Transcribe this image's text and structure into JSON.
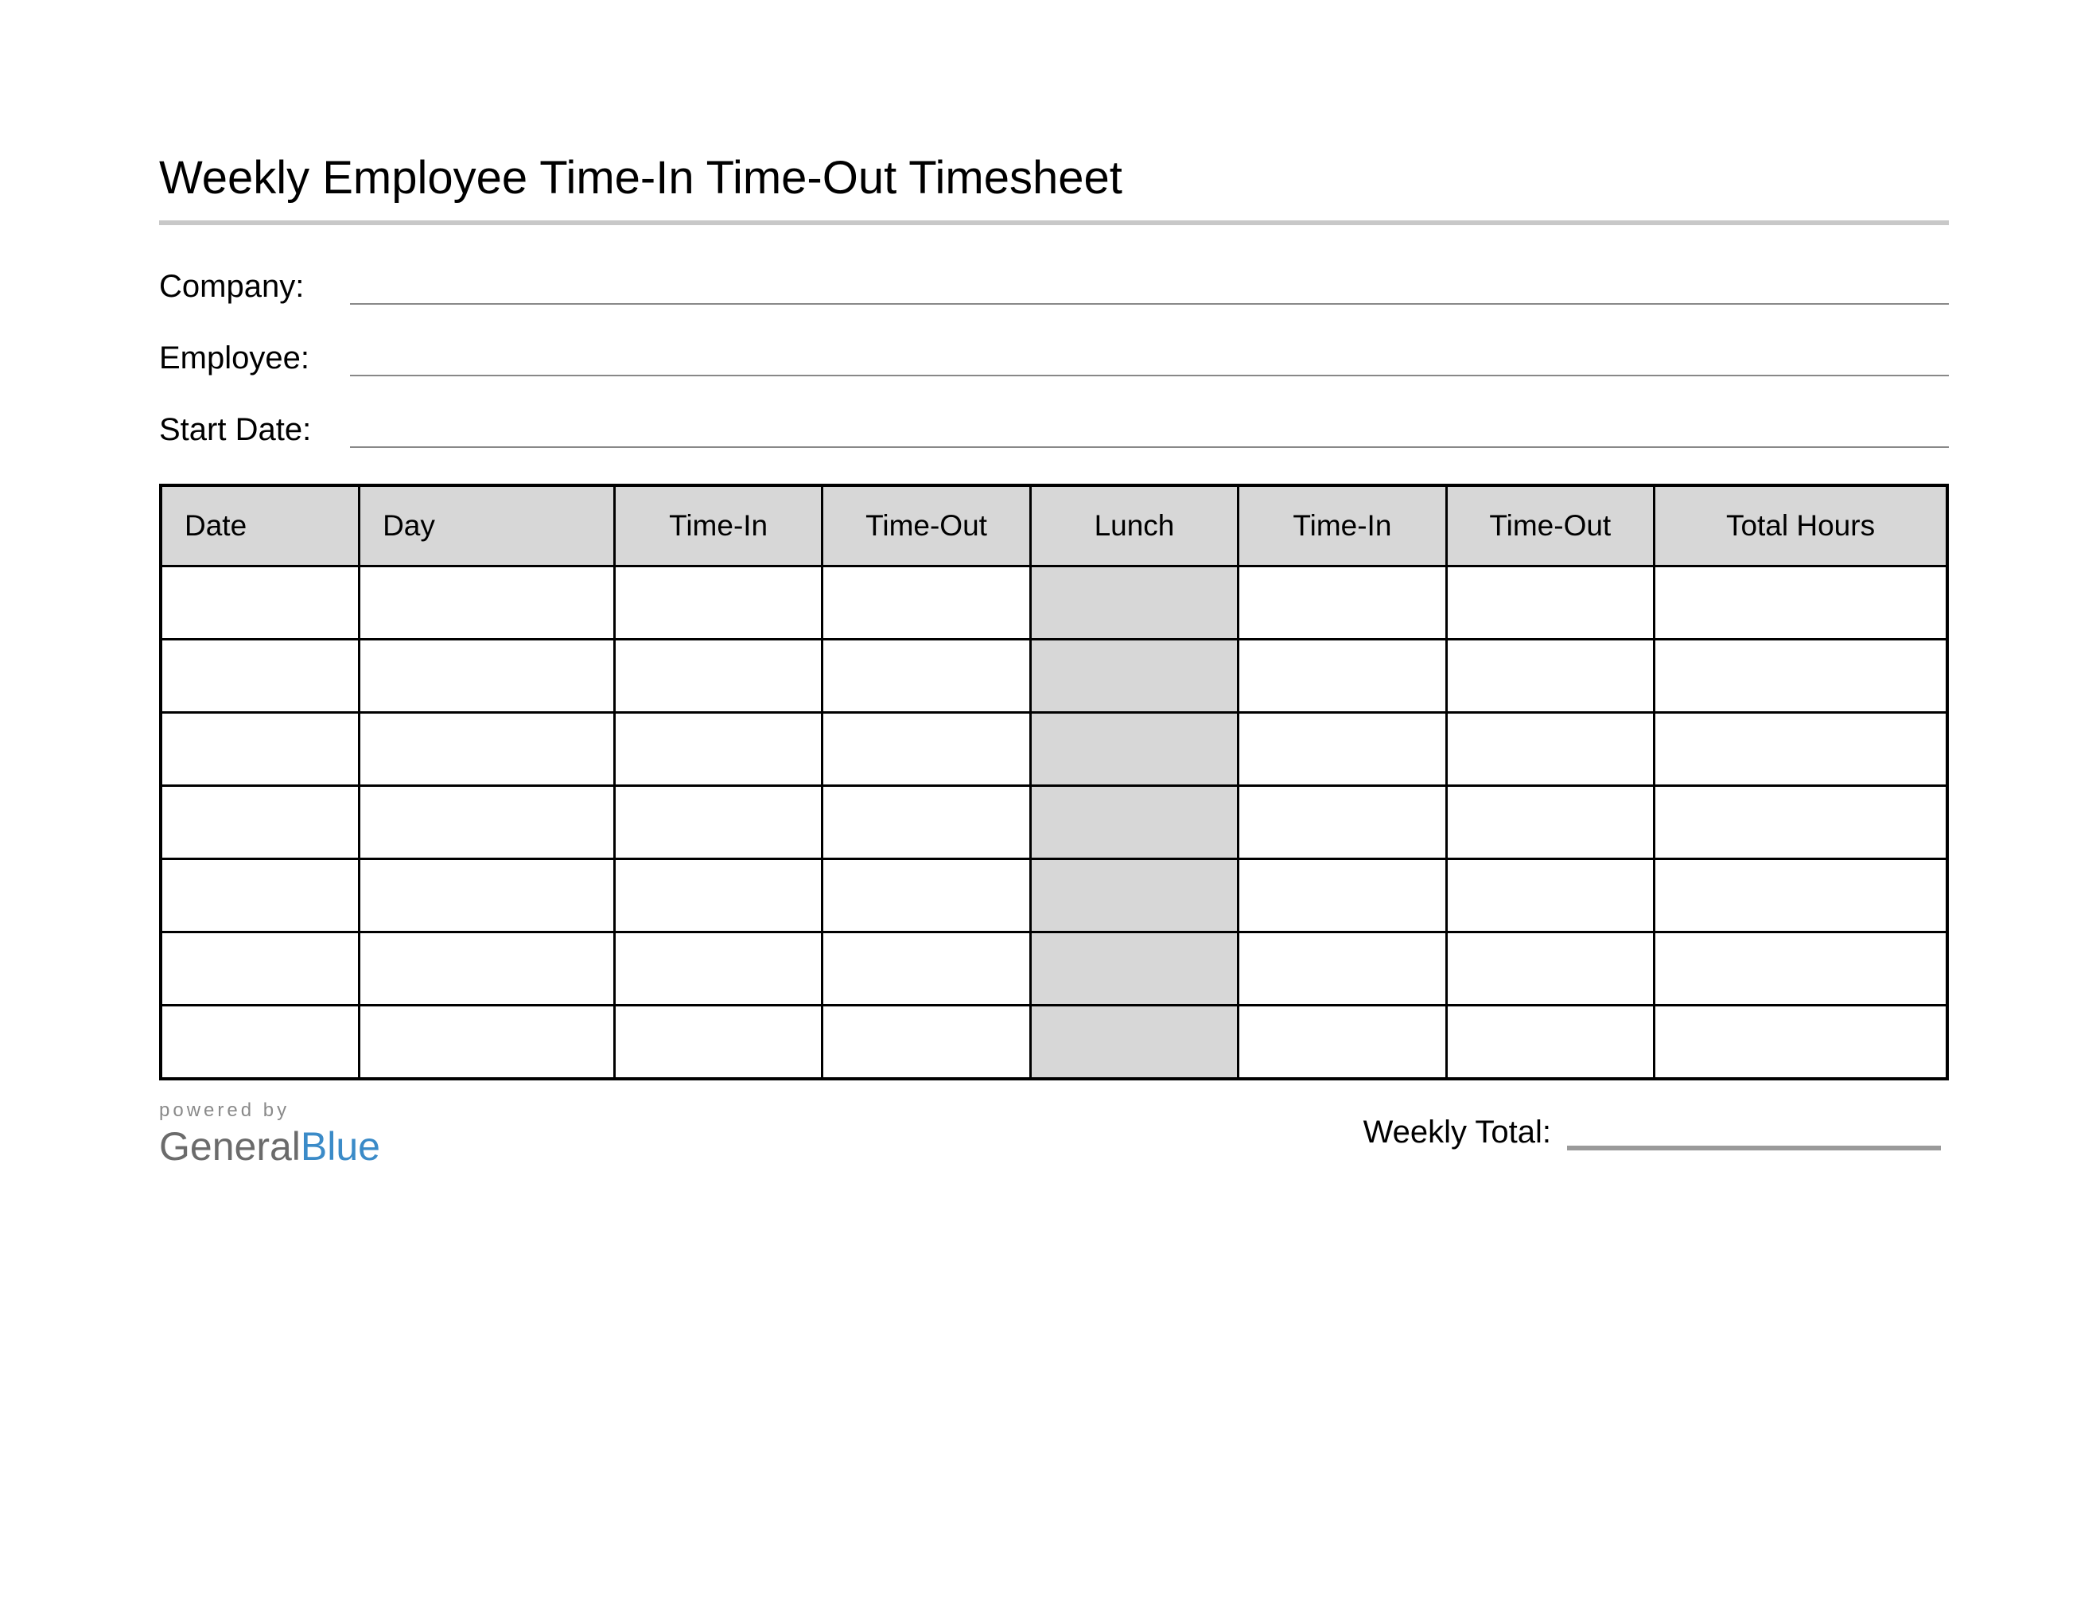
{
  "title": "Weekly Employee Time-In Time-Out Timesheet",
  "fields": {
    "company": {
      "label": "Company:",
      "value": ""
    },
    "employee": {
      "label": "Employee:",
      "value": ""
    },
    "start_date": {
      "label": "Start Date:",
      "value": ""
    }
  },
  "table": {
    "headers": [
      "Date",
      "Day",
      "Time-In",
      "Time-Out",
      "Lunch",
      "Time-In",
      "Time-Out",
      "Total Hours"
    ],
    "rows": [
      {
        "date": "",
        "day": "",
        "time_in_1": "",
        "time_out_1": "",
        "lunch": "",
        "time_in_2": "",
        "time_out_2": "",
        "total_hours": ""
      },
      {
        "date": "",
        "day": "",
        "time_in_1": "",
        "time_out_1": "",
        "lunch": "",
        "time_in_2": "",
        "time_out_2": "",
        "total_hours": ""
      },
      {
        "date": "",
        "day": "",
        "time_in_1": "",
        "time_out_1": "",
        "lunch": "",
        "time_in_2": "",
        "time_out_2": "",
        "total_hours": ""
      },
      {
        "date": "",
        "day": "",
        "time_in_1": "",
        "time_out_1": "",
        "lunch": "",
        "time_in_2": "",
        "time_out_2": "",
        "total_hours": ""
      },
      {
        "date": "",
        "day": "",
        "time_in_1": "",
        "time_out_1": "",
        "lunch": "",
        "time_in_2": "",
        "time_out_2": "",
        "total_hours": ""
      },
      {
        "date": "",
        "day": "",
        "time_in_1": "",
        "time_out_1": "",
        "lunch": "",
        "time_in_2": "",
        "time_out_2": "",
        "total_hours": ""
      },
      {
        "date": "",
        "day": "",
        "time_in_1": "",
        "time_out_1": "",
        "lunch": "",
        "time_in_2": "",
        "time_out_2": "",
        "total_hours": ""
      }
    ]
  },
  "footer": {
    "powered_by": "powered by",
    "logo_part1": "General",
    "logo_part2": "Blue",
    "weekly_total_label": "Weekly Total:",
    "weekly_total_value": ""
  }
}
